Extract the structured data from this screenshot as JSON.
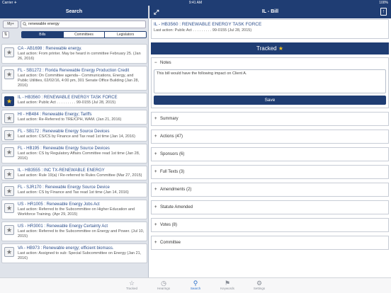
{
  "statusbar": {
    "carrier": "Carrier ✈",
    "time": "9:41 AM",
    "battery": "100%"
  },
  "left": {
    "title": "Search",
    "my_button": "My+",
    "search_value": "renewable energy",
    "sort_icon": "sort-icon",
    "segments": [
      "Bills",
      "Committees",
      "Legislators"
    ],
    "active_segment": "Bills",
    "bills": [
      {
        "title": "CA - AB1698 : Renewable energy.",
        "sub": "Last action: From printer. May be heard in committee February 25. (Jan 26, 2016)",
        "tracked": false
      },
      {
        "title": "FL - SB1272 : Florida Renewable Energy Production Credit",
        "sub": "Last action: On Committee agenda-- Communications, Energy, and Public Utilities, 02/02/16, 4:00 pm, 301 Senate Office Building (Jan 28, 2016)",
        "tracked": false
      },
      {
        "title": "IL - HB3560 : RENEWABLE ENERGY TASK FORCE",
        "sub": "Last action: Public Act . . . . . . . . . 99-0155 (Jul 28, 2015)",
        "tracked": true
      },
      {
        "title": "HI - HB484 : Renewable Energy; Tariffs",
        "sub": "Last action: Re-Referred to TRE/CPH, WAM. (Jan 21, 2016)",
        "tracked": false
      },
      {
        "title": "FL - SB172 : Renewable Energy Source Devices",
        "sub": "Last action: CS/CS by Finance and Tax read 1st time (Jan 14, 2016)",
        "tracked": false
      },
      {
        "title": "FL - HB195 : Renewable Energy Source Devices",
        "sub": "Last action: CS by Regulatory Affairs Committee read 1st time (Jan 28, 2016)",
        "tracked": false
      },
      {
        "title": "IL - HB3555 : INC TX-RENEWABLE ENERGY",
        "sub": "Last action: Rule 19(a) / Re-referred to Rules Committee (Mar 27, 2015)",
        "tracked": false
      },
      {
        "title": "FL - SJR170 : Renewable Energy Source Device",
        "sub": "Last action: CS by Finance and Tax read 1st time (Jan 14, 2016)",
        "tracked": false
      },
      {
        "title": "US - HR1005 : Renewable Energy Jobs Act",
        "sub": "Last action: Referred to the Subcommittee on Higher Education and Workforce Training. (Apr 29, 2015)",
        "tracked": false
      },
      {
        "title": "US - HR3001 : Renewable Energy Certainty Act",
        "sub": "Last action: Referred to the Subcommittee on Energy and Power. (Jul 10, 2015)",
        "tracked": false
      },
      {
        "title": "VA - HB973 : Renewable energy; efficient biomass.",
        "sub": "Last action: Assigned to sub: Special Subcommittee on Energy (Jan 21, 2016)",
        "tracked": false
      }
    ]
  },
  "right": {
    "header_title": "IL - Bill",
    "bill_title": "IL - HB3560 : RENEWABLE ENERGY TASK FORCE",
    "bill_sub": "Last action: Public Act . . . . . . . . . 99-0155 (Jul 28, 2015)",
    "tracked_label": "Tracked",
    "notes_label": "Notes",
    "notes_text": "This bill would have the following impact on Client A.",
    "save_label": "Save",
    "sections": [
      "Summary",
      "Actions (47)",
      "Sponsors (6)",
      "Full Texts (3)",
      "Amendments (2)",
      "Statute Amended",
      "Votes (8)",
      "Committee"
    ]
  },
  "tabbar": [
    {
      "label": "Tracked",
      "icon": "star-icon",
      "active": false
    },
    {
      "label": "Hearings",
      "icon": "clock-icon",
      "active": false
    },
    {
      "label": "Search",
      "icon": "search-icon",
      "active": true
    },
    {
      "label": "Keywords",
      "icon": "keywords-icon",
      "active": false
    },
    {
      "label": "Settings",
      "icon": "gear-icon",
      "active": false
    }
  ],
  "colors": {
    "navy": "#1f3d73",
    "link": "#2d4f8c",
    "star": "#f5c518",
    "tab_active": "#2a6fc9"
  }
}
